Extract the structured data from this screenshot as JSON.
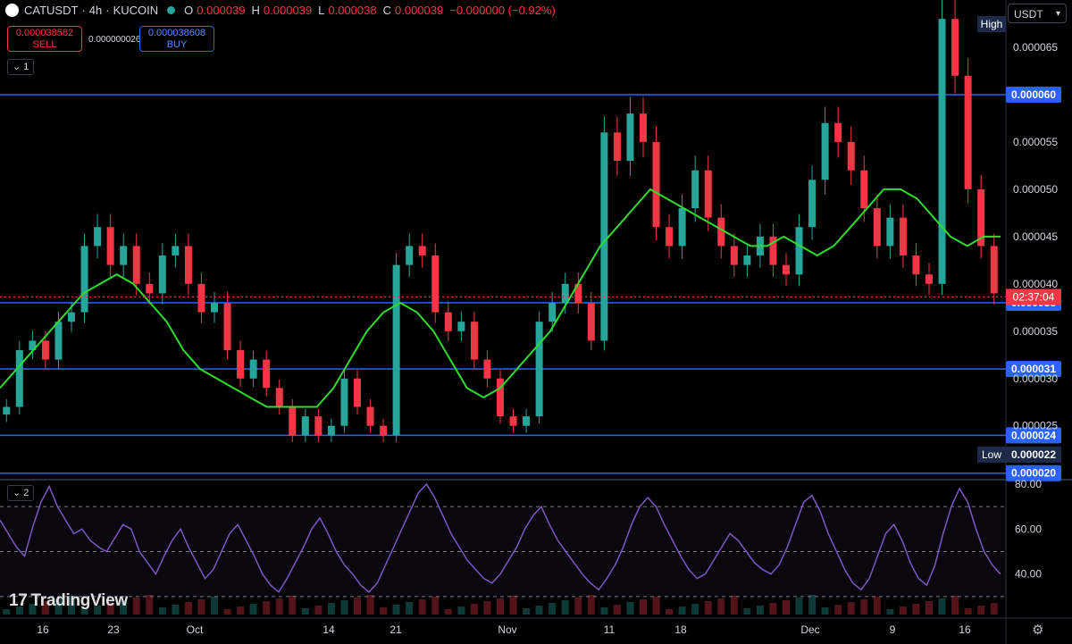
{
  "header": {
    "symbol": "CATUSDT",
    "separator_1": "·",
    "interval": "4h",
    "separator_2": "·",
    "exchange": "KUCOIN",
    "o_label": "O",
    "o_value": "0.000039",
    "h_label": "H",
    "h_value": "0.000039",
    "l_label": "L",
    "l_value": "0.000038",
    "c_label": "C",
    "c_value": "0.000039",
    "change": "−0.000000 (−0.92%)"
  },
  "trade": {
    "sell_price": "0.000038582",
    "sell_label": "SELL",
    "spread": "0.000000026",
    "buy_price": "0.000038608",
    "buy_label": "BUY"
  },
  "currency_select": "USDT",
  "pane_tags": {
    "main": "1",
    "rsi": "2"
  },
  "logo_text": "TradingView",
  "colors": {
    "background": "#000000",
    "bull": "#26a69a",
    "bear": "#f23645",
    "ma": "#2fdc2f",
    "level_line": "#2962ff",
    "rsi_line": "#7e57c2",
    "price_tag": "#f23645"
  },
  "icons": [
    "coin-icon",
    "live-dot-icon",
    "chevron-down-icon",
    "tradingview-logo-icon",
    "settings-gear-icon"
  ],
  "chart_data": {
    "type": "candlestick",
    "symbol": "CATUSDT",
    "price_axis": {
      "ticks": [
        "0.000065",
        "0.000055",
        "0.000050",
        "0.000045",
        "0.000040",
        "0.000035",
        "0.000030",
        "0.000025"
      ],
      "range": [
        1.95e-05,
        7e-05
      ]
    },
    "x_axis_labels": [
      "16",
      "23",
      "Oct",
      "14",
      "21",
      "Nov",
      "11",
      "18",
      "Dec",
      "9",
      "16"
    ],
    "horizontal_levels": [
      "0.000060",
      "0.000038",
      "0.000031",
      "0.000024",
      "0.000020"
    ],
    "markers": {
      "high_label": "High",
      "low_label": "Low",
      "low_value": "0.000022",
      "current_price": "0.000039",
      "countdown": "02:37:04"
    },
    "close_series": [
      2.7e-05,
      3.3e-05,
      3.4e-05,
      3.2e-05,
      3.6e-05,
      3.7e-05,
      4.4e-05,
      4.6e-05,
      4.2e-05,
      4.4e-05,
      4e-05,
      3.9e-05,
      4.3e-05,
      4.4e-05,
      4e-05,
      3.7e-05,
      3.8e-05,
      3.3e-05,
      3e-05,
      3.2e-05,
      2.9e-05,
      2.7e-05,
      2.4e-05,
      2.6e-05,
      2.4e-05,
      2.5e-05,
      3e-05,
      2.7e-05,
      2.5e-05,
      2.4e-05,
      4.2e-05,
      4.4e-05,
      4.3e-05,
      3.7e-05,
      3.5e-05,
      3.6e-05,
      3.2e-05,
      3e-05,
      2.6e-05,
      2.5e-05,
      2.6e-05,
      3.6e-05,
      3.8e-05,
      4e-05,
      3.8e-05,
      3.4e-05,
      5.6e-05,
      5.3e-05,
      5.8e-05,
      5.5e-05,
      4.6e-05,
      4.4e-05,
      4.8e-05,
      5.2e-05,
      4.7e-05,
      4.4e-05,
      4.2e-05,
      4.3e-05,
      4.5e-05,
      4.2e-05,
      4.1e-05,
      4.6e-05,
      5.1e-05,
      5.7e-05,
      5.5e-05,
      5.2e-05,
      4.8e-05,
      4.4e-05,
      4.7e-05,
      4.3e-05,
      4.1e-05,
      4e-05,
      6.8e-05,
      6.2e-05,
      5e-05,
      4.4e-05,
      3.9e-05
    ],
    "ma_series": [
      2.9e-05,
      3.1e-05,
      3.3e-05,
      3.5e-05,
      3.7e-05,
      3.9e-05,
      4e-05,
      4.1e-05,
      4e-05,
      3.8e-05,
      3.6e-05,
      3.3e-05,
      3.1e-05,
      3e-05,
      2.9e-05,
      2.8e-05,
      2.7e-05,
      2.7e-05,
      2.7e-05,
      2.7e-05,
      2.9e-05,
      3.2e-05,
      3.5e-05,
      3.7e-05,
      3.8e-05,
      3.7e-05,
      3.5e-05,
      3.2e-05,
      2.9e-05,
      2.8e-05,
      2.9e-05,
      3.1e-05,
      3.3e-05,
      3.5e-05,
      3.8e-05,
      4.1e-05,
      4.4e-05,
      4.6e-05,
      4.8e-05,
      5e-05,
      4.9e-05,
      4.8e-05,
      4.7e-05,
      4.6e-05,
      4.5e-05,
      4.4e-05,
      4.4e-05,
      4.5e-05,
      4.4e-05,
      4.3e-05,
      4.4e-05,
      4.6e-05,
      4.8e-05,
      5e-05,
      5e-05,
      4.9e-05,
      4.7e-05,
      4.5e-05,
      4.4e-05,
      4.5e-05,
      4.5e-05
    ],
    "rsi": {
      "axis_ticks": [
        "80.00",
        "60.00",
        "40.00"
      ],
      "range": [
        22,
        80
      ],
      "band_upper": 70,
      "band_middle": 50,
      "band_lower": 30,
      "values": [
        64,
        58,
        52,
        48,
        61,
        72,
        79,
        70,
        64,
        58,
        60,
        55,
        52,
        50,
        56,
        62,
        60,
        50,
        45,
        40,
        48,
        55,
        60,
        52,
        45,
        38,
        42,
        50,
        58,
        62,
        55,
        48,
        40,
        35,
        32,
        38,
        45,
        52,
        60,
        65,
        58,
        50,
        44,
        40,
        35,
        32,
        36,
        44,
        52,
        60,
        68,
        76,
        80,
        74,
        66,
        58,
        52,
        46,
        42,
        38,
        36,
        40,
        46,
        52,
        60,
        66,
        70,
        62,
        55,
        50,
        45,
        40,
        36,
        33,
        38,
        44,
        52,
        62,
        70,
        74,
        70,
        62,
        55,
        48,
        42,
        38,
        40,
        46,
        52,
        58,
        55,
        50,
        45,
        42,
        40,
        44,
        52,
        62,
        72,
        75,
        68,
        58,
        50,
        42,
        36,
        33,
        38,
        48,
        58,
        62,
        55,
        45,
        38,
        35,
        44,
        58,
        70,
        78,
        72,
        60,
        50,
        44,
        40
      ]
    }
  }
}
